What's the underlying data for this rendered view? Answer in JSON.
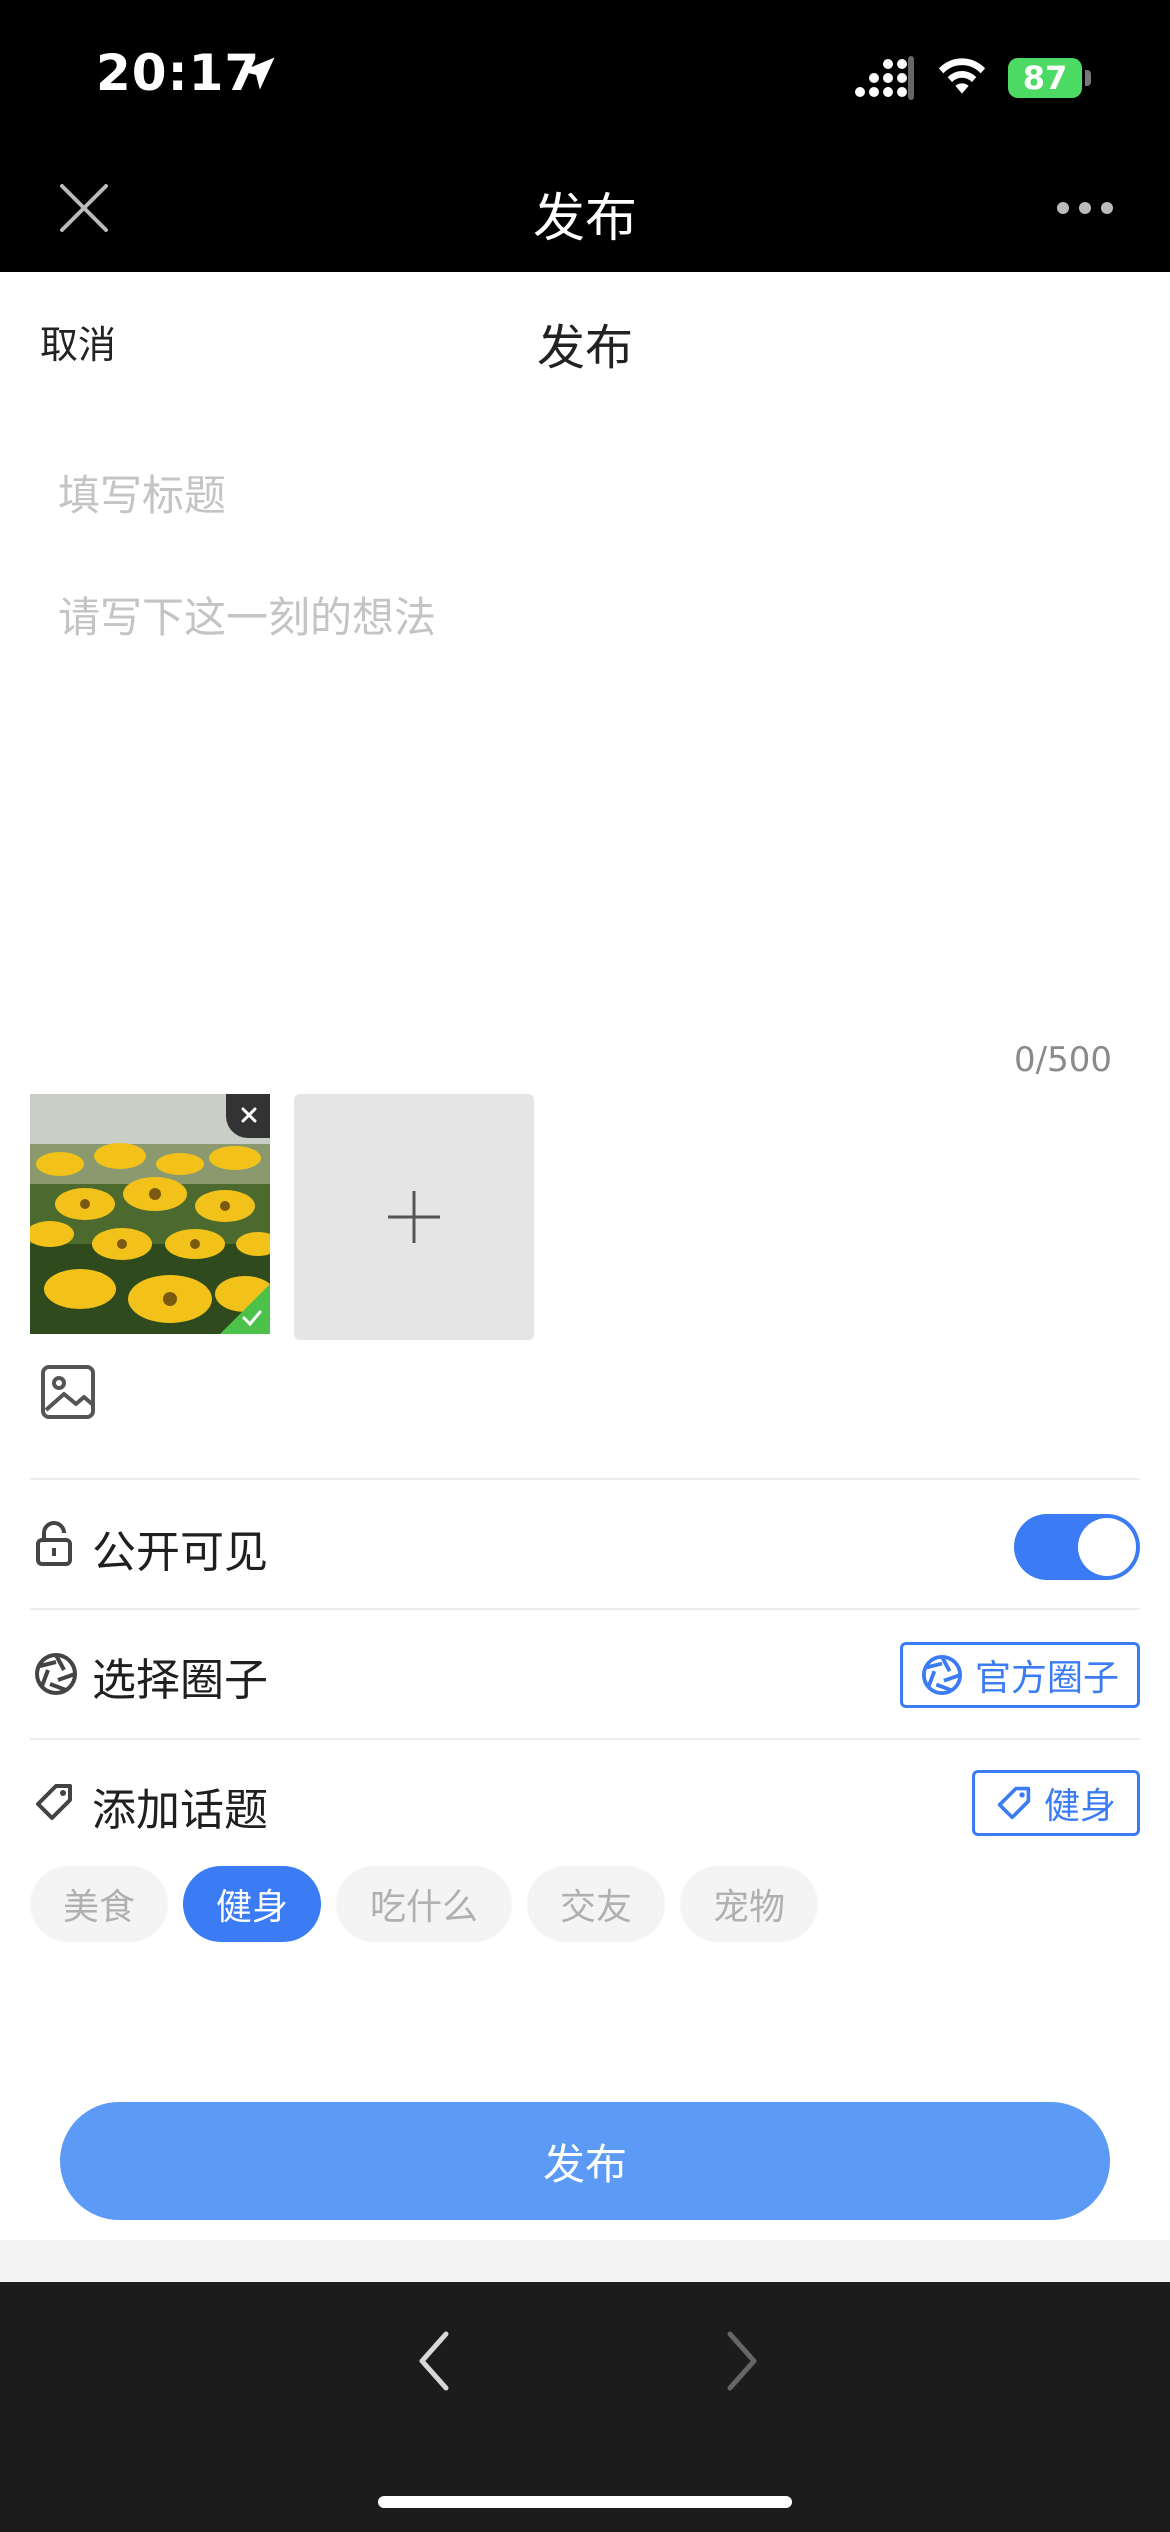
{
  "status": {
    "time": "20:17",
    "battery": "87"
  },
  "nav": {
    "title": "发布"
  },
  "header": {
    "cancel": "取消",
    "title": "发布"
  },
  "form": {
    "title_placeholder": "填写标题",
    "content_placeholder": "请写下这一刻的想法",
    "counter": "0/500"
  },
  "settings": {
    "visibility_label": "公开可见",
    "visibility_on": true,
    "circle_label": "选择圈子",
    "circle_value": "官方圈子",
    "topic_label": "添加话题",
    "topic_value": "健身"
  },
  "topics": [
    {
      "label": "美食",
      "active": false
    },
    {
      "label": "健身",
      "active": true
    },
    {
      "label": "吃什么",
      "active": false
    },
    {
      "label": "交友",
      "active": false
    },
    {
      "label": "宠物",
      "active": false
    }
  ],
  "publish_button": "发布",
  "colors": {
    "accent": "#3b7cf4",
    "publish": "#5b9bf5",
    "check": "#4cc24a"
  }
}
